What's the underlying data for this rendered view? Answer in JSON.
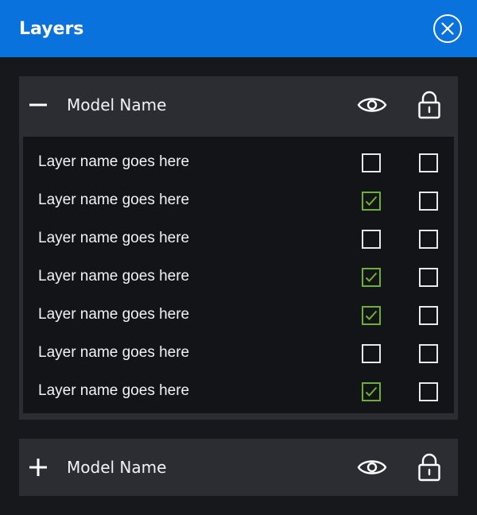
{
  "header": {
    "title": "Layers"
  },
  "models": [
    {
      "name": "Model Name",
      "expanded": true,
      "layers": [
        {
          "label": "Layer name goes here",
          "visible": false,
          "locked": false
        },
        {
          "label": "Layer name goes here",
          "visible": true,
          "locked": false
        },
        {
          "label": "Layer name goes here",
          "visible": false,
          "locked": false
        },
        {
          "label": "Layer name goes here",
          "visible": true,
          "locked": false
        },
        {
          "label": "Layer name goes here",
          "visible": true,
          "locked": false
        },
        {
          "label": "Layer name goes here",
          "visible": false,
          "locked": false
        },
        {
          "label": "Layer name goes here",
          "visible": true,
          "locked": false
        }
      ]
    },
    {
      "name": "Model Name",
      "expanded": false,
      "layers": []
    }
  ],
  "colors": {
    "header_bg": "#0a72dc",
    "panel_bg": "#16181c",
    "model_bg": "#2b2d32",
    "list_bg": "#121418",
    "check_green": "#6fb12a"
  },
  "icons": {
    "close": "close-circle-icon",
    "collapse": "minus-icon",
    "expand": "plus-icon",
    "visibility": "eye-icon",
    "lock": "lock-icon",
    "check": "checkmark-icon"
  }
}
